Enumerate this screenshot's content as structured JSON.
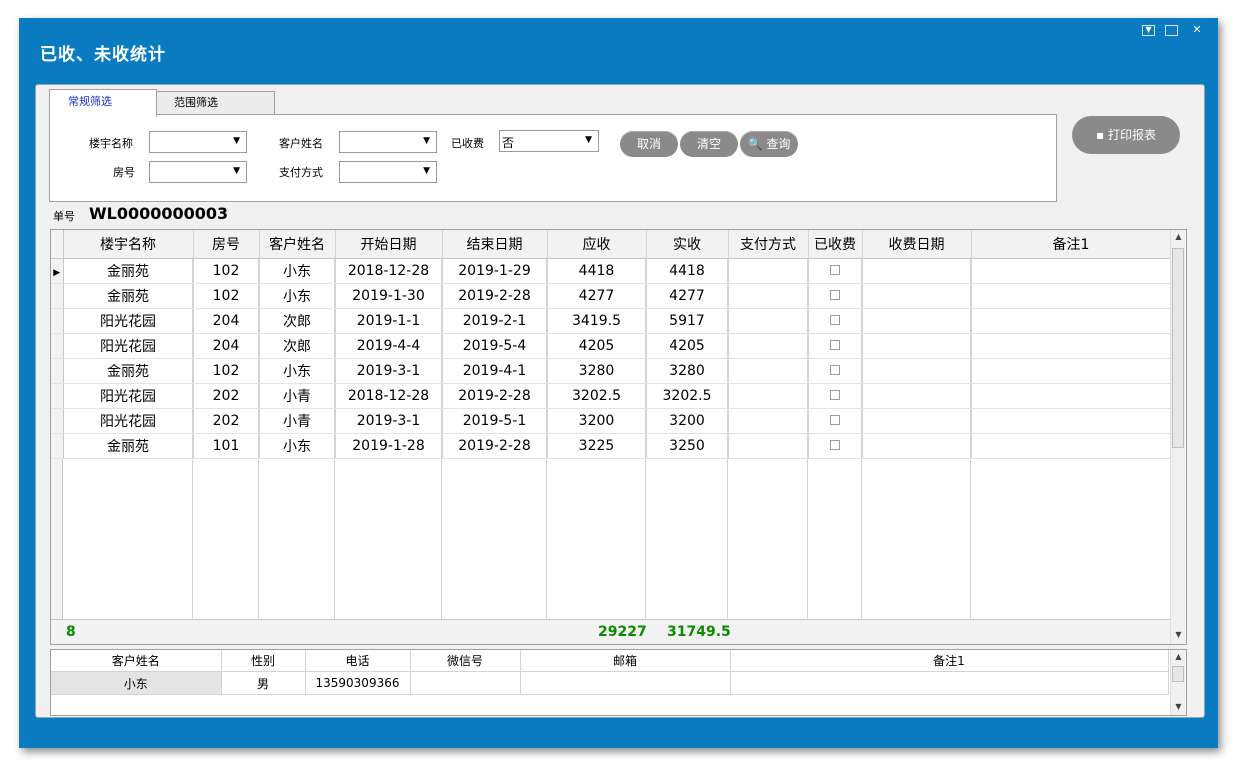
{
  "window": {
    "title": "已收、未收统计"
  },
  "tabs": [
    {
      "label": "常规筛选"
    },
    {
      "label": "范围筛选"
    }
  ],
  "filters": {
    "building_label": "楼宇名称",
    "room_label": "房号",
    "customer_label": "客户姓名",
    "payment_label": "支付方式",
    "received_label": "已收费",
    "received_value": "否"
  },
  "buttons": {
    "cancel": "取消",
    "clear": "清空",
    "query": "查询",
    "print": "打印报表"
  },
  "order": {
    "label": "单号",
    "number": "WL0000000003"
  },
  "grid": {
    "columns": [
      "楼宇名称",
      "房号",
      "客户姓名",
      "开始日期",
      "结束日期",
      "应收",
      "实收",
      "支付方式",
      "已收费",
      "收费日期",
      "备注1"
    ],
    "rows": [
      [
        "金丽苑",
        "102",
        "小东",
        "2018-12-28",
        "2019-1-29",
        "4418",
        "4418"
      ],
      [
        "金丽苑",
        "102",
        "小东",
        "2019-1-30",
        "2019-2-28",
        "4277",
        "4277"
      ],
      [
        "阳光花园",
        "204",
        "次郎",
        "2019-1-1",
        "2019-2-1",
        "3419.5",
        "5917"
      ],
      [
        "阳光花园",
        "204",
        "次郎",
        "2019-4-4",
        "2019-5-4",
        "4205",
        "4205"
      ],
      [
        "金丽苑",
        "102",
        "小东",
        "2019-3-1",
        "2019-4-1",
        "3280",
        "3280"
      ],
      [
        "阳光花园",
        "202",
        "小青",
        "2018-12-28",
        "2019-2-28",
        "3202.5",
        "3202.5"
      ],
      [
        "阳光花园",
        "202",
        "小青",
        "2019-3-1",
        "2019-5-1",
        "3200",
        "3200"
      ],
      [
        "金丽苑",
        "101",
        "小东",
        "2019-1-28",
        "2019-2-28",
        "3225",
        "3250"
      ]
    ],
    "summary": {
      "count": "8",
      "receivable_total": "29227",
      "received_total": "31749.5"
    }
  },
  "detail": {
    "columns": [
      "客户姓名",
      "性别",
      "电话",
      "微信号",
      "邮箱",
      "备注1"
    ],
    "row": [
      "小东",
      "男",
      "13590309366",
      "",
      "",
      ""
    ]
  }
}
